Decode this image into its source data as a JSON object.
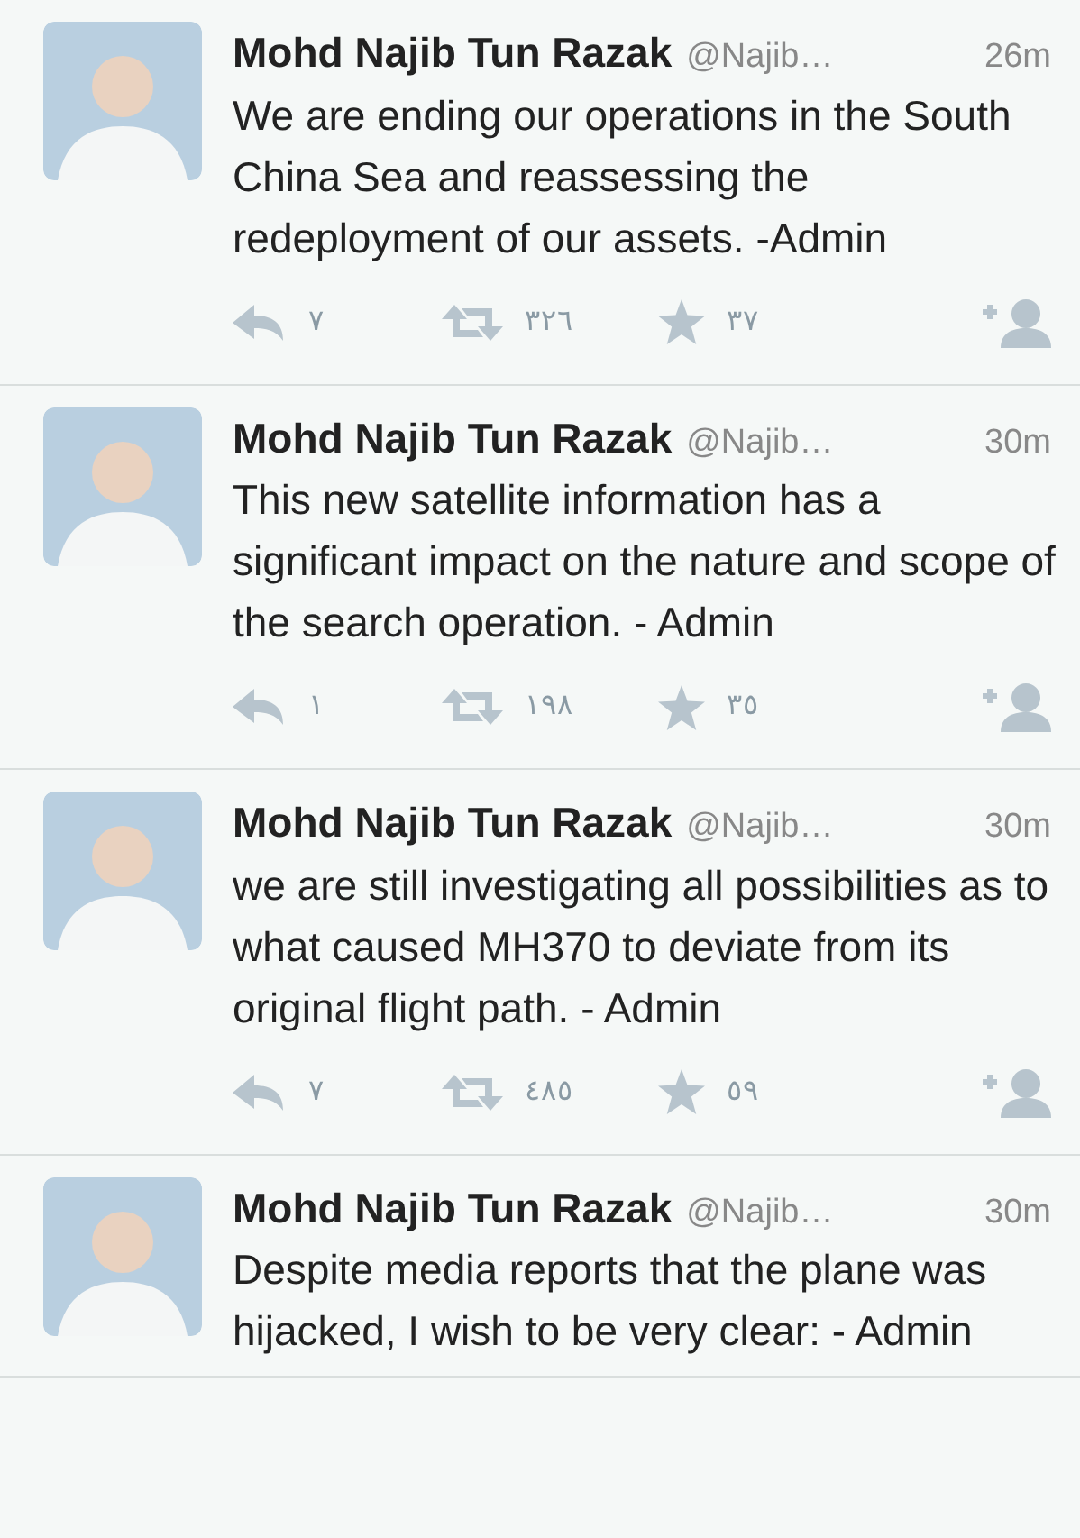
{
  "tweets": [
    {
      "name": "Mohd Najib Tun Razak",
      "handle": "@Najib…",
      "time": "26m",
      "text": "We are ending our operations in the South China Sea and reassessing the redeployment of our assets. -Admin",
      "replies": "٧",
      "retweets": "٣٢٦",
      "favorites": "٣٧"
    },
    {
      "name": "Mohd Najib Tun Razak",
      "handle": "@Najib…",
      "time": "30m",
      "text": "This new satellite information has a significant impact on the nature and scope of the search operation. - Admin",
      "replies": "١",
      "retweets": "١٩٨",
      "favorites": "٣٥"
    },
    {
      "name": "Mohd Najib Tun Razak",
      "handle": "@Najib…",
      "time": "30m",
      "text": "we are still investigating all possibilities as to what caused MH370 to deviate from its original flight path. - Admin",
      "replies": "٧",
      "retweets": "٤٨٥",
      "favorites": "٥٩"
    },
    {
      "name": "Mohd Najib Tun Razak",
      "handle": "@Najib…",
      "time": "30m",
      "text": "Despite media reports that the plane was hijacked, I wish to be very clear: - Admin"
    }
  ]
}
